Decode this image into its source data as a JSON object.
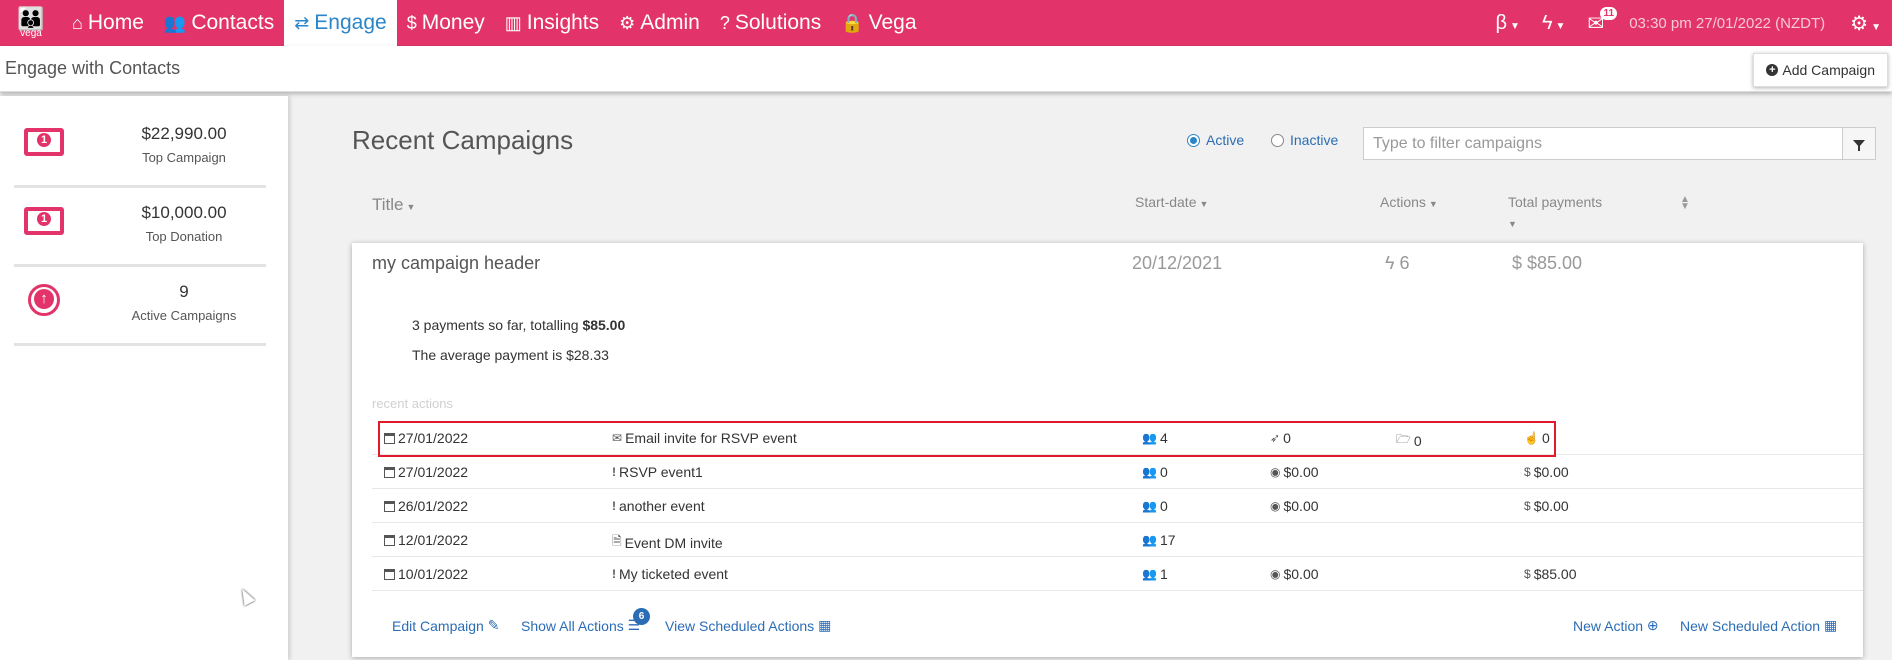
{
  "nav": {
    "logo_text": "vega",
    "items": [
      {
        "label": "Home",
        "icon": "home-icon",
        "glyph": "⌂"
      },
      {
        "label": "Contacts",
        "icon": "users-icon",
        "glyph": "👥"
      },
      {
        "label": "Engage",
        "icon": "exchange-icon",
        "glyph": "⇄"
      },
      {
        "label": "Money",
        "icon": "dollar-icon",
        "glyph": "$"
      },
      {
        "label": "Insights",
        "icon": "bar-chart-icon",
        "glyph": "▥"
      },
      {
        "label": "Admin",
        "icon": "gears-icon",
        "glyph": "⚙"
      },
      {
        "label": "Solutions",
        "icon": "question-circle-icon",
        "glyph": "?"
      },
      {
        "label": "Vega",
        "icon": "lock-icon",
        "glyph": "🔒"
      }
    ],
    "beta": "β",
    "mail_count": "11",
    "datetime": "03:30 pm 27/01/2022 (NZDT)"
  },
  "subheader": {
    "title": "Engage with Contacts",
    "add_campaign": "Add Campaign"
  },
  "stats": [
    {
      "value": "$22,990.00",
      "label": "Top Campaign",
      "icon": "money-bill-icon"
    },
    {
      "value": "$10,000.00",
      "label": "Top Donation",
      "icon": "money-bill-icon"
    },
    {
      "value": "9",
      "label": "Active Campaigns",
      "icon": "arrow-circle-up-icon"
    }
  ],
  "main": {
    "title": "Recent Campaigns",
    "radio_active": "Active",
    "radio_inactive": "Inactive",
    "filter_placeholder": "Type to filter campaigns",
    "columns": {
      "title": "Title",
      "start_date": "Start-date",
      "actions": "Actions",
      "total_payments": "Total payments"
    }
  },
  "campaign": {
    "title": "my campaign header",
    "start_date": "20/12/2021",
    "actions": "6",
    "payments": "$85.00",
    "summary_prefix": "3 payments so far, totalling ",
    "summary_total": "$85.00",
    "average": "The average payment is $28.33",
    "recent_label": "recent actions"
  },
  "actions": [
    {
      "date": "27/01/2022",
      "type": "email",
      "name": "Email invite for RSVP event",
      "people": "4",
      "c1": "0",
      "c2": "0",
      "c3": "0",
      "highlight": true
    },
    {
      "date": "27/01/2022",
      "type": "event",
      "name": "RSVP event1",
      "people": "0",
      "c1": "$0.00",
      "c2": "",
      "c3": "$0.00"
    },
    {
      "date": "26/01/2022",
      "type": "event",
      "name": "another event",
      "people": "0",
      "c1": "$0.00",
      "c2": "",
      "c3": "$0.00"
    },
    {
      "date": "12/01/2022",
      "type": "pdf",
      "name": "Event DM invite",
      "people": "17",
      "c1": "",
      "c2": "",
      "c3": ""
    },
    {
      "date": "10/01/2022",
      "type": "event",
      "name": "My ticketed event",
      "people": "1",
      "c1": "$0.00",
      "c2": "",
      "c3": "$85.00"
    }
  ],
  "footer": {
    "edit": "Edit Campaign",
    "show_all": "Show All Actions",
    "show_all_count": "6",
    "scheduled": "View Scheduled Actions",
    "new_action": "New Action",
    "new_scheduled": "New Scheduled Action"
  },
  "colors": {
    "brand": "#e2346a",
    "link": "#2b6db5",
    "highlight": "#e0192b"
  }
}
